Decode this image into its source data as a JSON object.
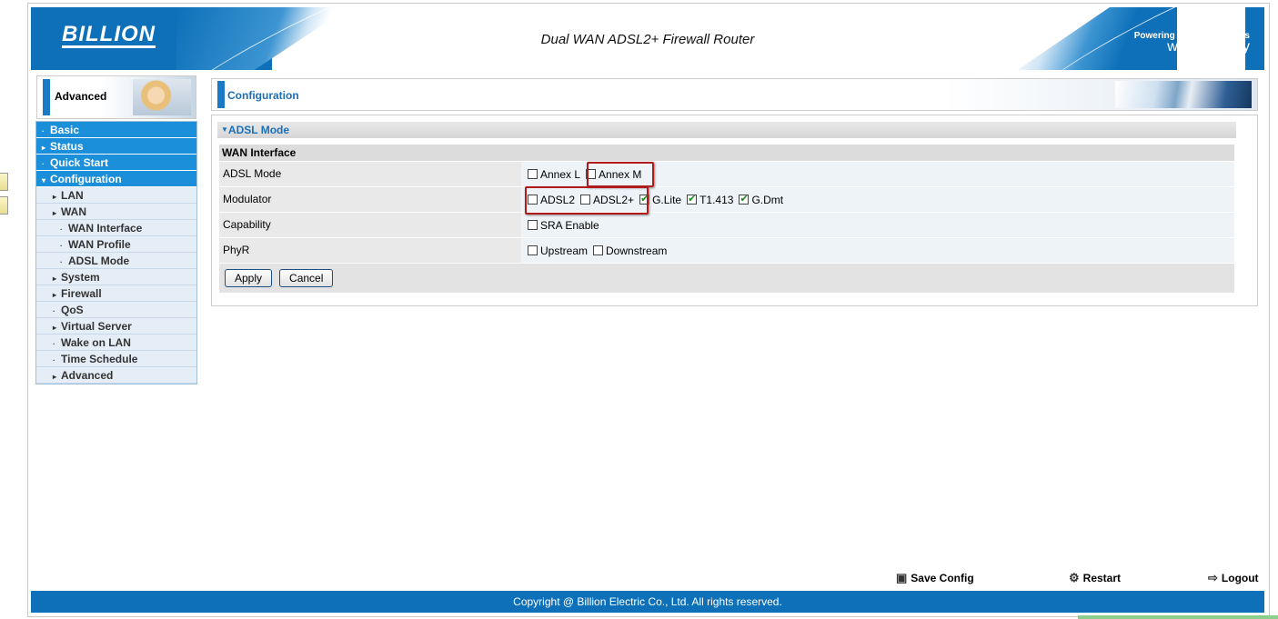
{
  "header": {
    "logo": "BILLION",
    "title": "Dual WAN ADSL2+ Firewall Router",
    "slogan_line1": "Powering communications",
    "slogan_line2": "with Security"
  },
  "left": {
    "mode_label": "Advanced",
    "nav": [
      {
        "label": "Basic",
        "level": 0,
        "marker": "·"
      },
      {
        "label": "Status",
        "level": 0,
        "marker": "▸"
      },
      {
        "label": "Quick Start",
        "level": 0,
        "marker": "·"
      },
      {
        "label": "Configuration",
        "level": 0,
        "marker": "▾"
      },
      {
        "label": "LAN",
        "level": 1,
        "marker": "▸"
      },
      {
        "label": "WAN",
        "level": 1,
        "marker": "▸"
      },
      {
        "label": "WAN Interface",
        "level": 2,
        "marker": "·"
      },
      {
        "label": "WAN Profile",
        "level": 2,
        "marker": "·"
      },
      {
        "label": "ADSL Mode",
        "level": 2,
        "marker": "·"
      },
      {
        "label": "System",
        "level": 1,
        "marker": "▸"
      },
      {
        "label": "Firewall",
        "level": 1,
        "marker": "▸"
      },
      {
        "label": "QoS",
        "level": 1,
        "marker": "·"
      },
      {
        "label": "Virtual Server",
        "level": 1,
        "marker": "▸"
      },
      {
        "label": "Wake on LAN",
        "level": 1,
        "marker": "·"
      },
      {
        "label": "Time Schedule",
        "level": 1,
        "marker": "·"
      },
      {
        "label": "Advanced",
        "level": 1,
        "marker": "▸"
      }
    ]
  },
  "main": {
    "page_title": "Configuration",
    "section_title": "ADSL Mode",
    "group_header": "WAN Interface",
    "rows": {
      "adsl_mode": {
        "label": "ADSL Mode",
        "options": [
          {
            "label": "Annex L",
            "checked": false
          },
          {
            "label": "Annex M",
            "checked": false
          }
        ]
      },
      "modulator": {
        "label": "Modulator",
        "options": [
          {
            "label": "ADSL2",
            "checked": false
          },
          {
            "label": "ADSL2+",
            "checked": false
          },
          {
            "label": "G.Lite",
            "checked": true
          },
          {
            "label": "T1.413",
            "checked": true
          },
          {
            "label": "G.Dmt",
            "checked": true
          }
        ]
      },
      "capability": {
        "label": "Capability",
        "options": [
          {
            "label": "SRA Enable",
            "checked": false
          }
        ]
      },
      "phyr": {
        "label": "PhyR",
        "options": [
          {
            "label": "Upstream",
            "checked": false
          },
          {
            "label": "Downstream",
            "checked": false
          }
        ]
      }
    },
    "apply_label": "Apply",
    "cancel_label": "Cancel"
  },
  "bottom": {
    "save_config": "Save Config",
    "restart": "Restart",
    "logout": "Logout",
    "copyright": "Copyright @ Billion Electric Co., Ltd. All rights reserved."
  },
  "colors": {
    "brand_blue": "#0d70b8",
    "nav_blue": "#1b8fda",
    "highlight_red": "#b01a1a",
    "check_green": "#1e8a1e"
  }
}
